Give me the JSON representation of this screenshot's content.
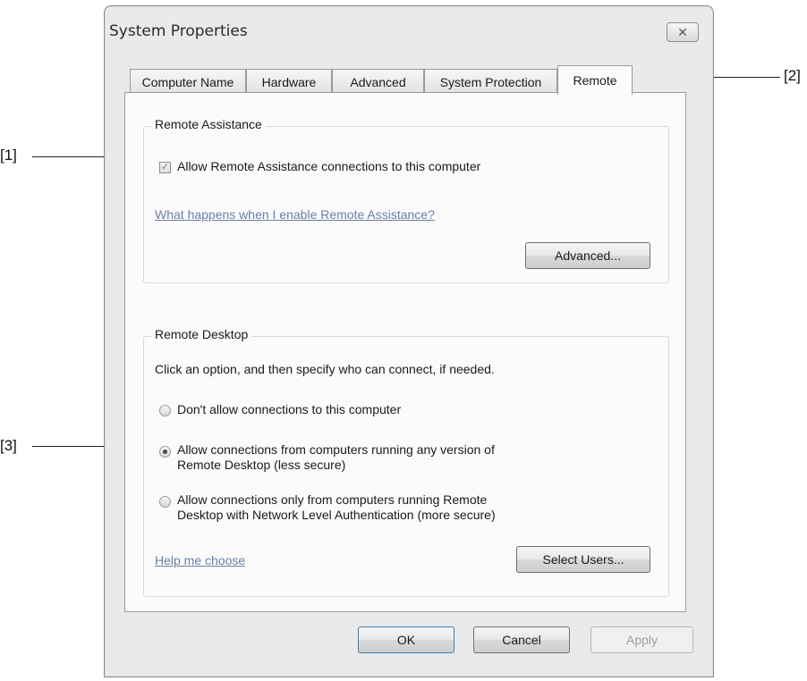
{
  "window": {
    "title": "System Properties",
    "close_glyph": "✕"
  },
  "tabs": [
    {
      "label": "Computer Name",
      "active": false
    },
    {
      "label": "Hardware",
      "active": false
    },
    {
      "label": "Advanced",
      "active": false
    },
    {
      "label": "System Protection",
      "active": false
    },
    {
      "label": "Remote",
      "active": true
    }
  ],
  "remote_assistance": {
    "group_title": "Remote Assistance",
    "checkbox_label": "Allow Remote Assistance connections to this computer",
    "checkbox_checked": true,
    "help_link": "What happens when I enable Remote Assistance?",
    "advanced_button": "Advanced..."
  },
  "remote_desktop": {
    "group_title": "Remote Desktop",
    "instruction": "Click an option, and then specify who can connect, if needed.",
    "options": [
      {
        "line1": "Don't allow connections to this computer",
        "line2": "",
        "checked": false
      },
      {
        "line1": "Allow connections from computers running any version of",
        "line2": "Remote Desktop (less secure)",
        "checked": true
      },
      {
        "line1": "Allow connections only from computers running Remote",
        "line2": "Desktop with Network Level Authentication (more secure)",
        "checked": false
      }
    ],
    "help_link": "Help me choose",
    "select_users_button": "Select Users..."
  },
  "footer": {
    "ok": "OK",
    "cancel": "Cancel",
    "apply": "Apply"
  },
  "callouts": {
    "c1": "[1]",
    "c2": "[2]",
    "c3": "[3]"
  }
}
